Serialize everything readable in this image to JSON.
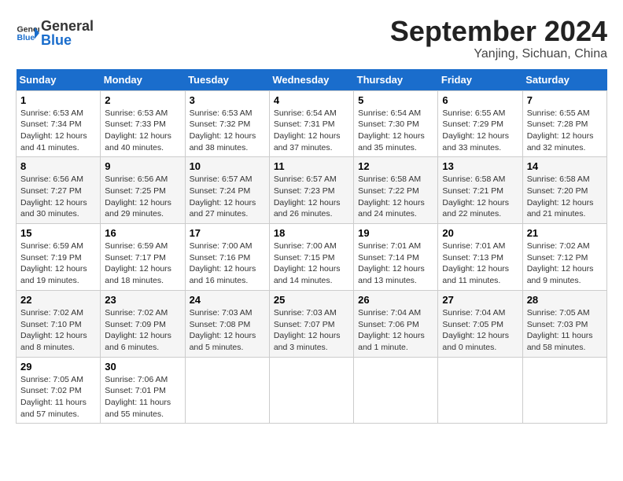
{
  "header": {
    "logo_text_general": "General",
    "logo_text_blue": "Blue",
    "month": "September 2024",
    "location": "Yanjing, Sichuan, China"
  },
  "weekdays": [
    "Sunday",
    "Monday",
    "Tuesday",
    "Wednesday",
    "Thursday",
    "Friday",
    "Saturday"
  ],
  "weeks": [
    [
      {
        "day": "1",
        "info": "Sunrise: 6:53 AM\nSunset: 7:34 PM\nDaylight: 12 hours and 41 minutes."
      },
      {
        "day": "2",
        "info": "Sunrise: 6:53 AM\nSunset: 7:33 PM\nDaylight: 12 hours and 40 minutes."
      },
      {
        "day": "3",
        "info": "Sunrise: 6:53 AM\nSunset: 7:32 PM\nDaylight: 12 hours and 38 minutes."
      },
      {
        "day": "4",
        "info": "Sunrise: 6:54 AM\nSunset: 7:31 PM\nDaylight: 12 hours and 37 minutes."
      },
      {
        "day": "5",
        "info": "Sunrise: 6:54 AM\nSunset: 7:30 PM\nDaylight: 12 hours and 35 minutes."
      },
      {
        "day": "6",
        "info": "Sunrise: 6:55 AM\nSunset: 7:29 PM\nDaylight: 12 hours and 33 minutes."
      },
      {
        "day": "7",
        "info": "Sunrise: 6:55 AM\nSunset: 7:28 PM\nDaylight: 12 hours and 32 minutes."
      }
    ],
    [
      {
        "day": "8",
        "info": "Sunrise: 6:56 AM\nSunset: 7:27 PM\nDaylight: 12 hours and 30 minutes."
      },
      {
        "day": "9",
        "info": "Sunrise: 6:56 AM\nSunset: 7:25 PM\nDaylight: 12 hours and 29 minutes."
      },
      {
        "day": "10",
        "info": "Sunrise: 6:57 AM\nSunset: 7:24 PM\nDaylight: 12 hours and 27 minutes."
      },
      {
        "day": "11",
        "info": "Sunrise: 6:57 AM\nSunset: 7:23 PM\nDaylight: 12 hours and 26 minutes."
      },
      {
        "day": "12",
        "info": "Sunrise: 6:58 AM\nSunset: 7:22 PM\nDaylight: 12 hours and 24 minutes."
      },
      {
        "day": "13",
        "info": "Sunrise: 6:58 AM\nSunset: 7:21 PM\nDaylight: 12 hours and 22 minutes."
      },
      {
        "day": "14",
        "info": "Sunrise: 6:58 AM\nSunset: 7:20 PM\nDaylight: 12 hours and 21 minutes."
      }
    ],
    [
      {
        "day": "15",
        "info": "Sunrise: 6:59 AM\nSunset: 7:19 PM\nDaylight: 12 hours and 19 minutes."
      },
      {
        "day": "16",
        "info": "Sunrise: 6:59 AM\nSunset: 7:17 PM\nDaylight: 12 hours and 18 minutes."
      },
      {
        "day": "17",
        "info": "Sunrise: 7:00 AM\nSunset: 7:16 PM\nDaylight: 12 hours and 16 minutes."
      },
      {
        "day": "18",
        "info": "Sunrise: 7:00 AM\nSunset: 7:15 PM\nDaylight: 12 hours and 14 minutes."
      },
      {
        "day": "19",
        "info": "Sunrise: 7:01 AM\nSunset: 7:14 PM\nDaylight: 12 hours and 13 minutes."
      },
      {
        "day": "20",
        "info": "Sunrise: 7:01 AM\nSunset: 7:13 PM\nDaylight: 12 hours and 11 minutes."
      },
      {
        "day": "21",
        "info": "Sunrise: 7:02 AM\nSunset: 7:12 PM\nDaylight: 12 hours and 9 minutes."
      }
    ],
    [
      {
        "day": "22",
        "info": "Sunrise: 7:02 AM\nSunset: 7:10 PM\nDaylight: 12 hours and 8 minutes."
      },
      {
        "day": "23",
        "info": "Sunrise: 7:02 AM\nSunset: 7:09 PM\nDaylight: 12 hours and 6 minutes."
      },
      {
        "day": "24",
        "info": "Sunrise: 7:03 AM\nSunset: 7:08 PM\nDaylight: 12 hours and 5 minutes."
      },
      {
        "day": "25",
        "info": "Sunrise: 7:03 AM\nSunset: 7:07 PM\nDaylight: 12 hours and 3 minutes."
      },
      {
        "day": "26",
        "info": "Sunrise: 7:04 AM\nSunset: 7:06 PM\nDaylight: 12 hours and 1 minute."
      },
      {
        "day": "27",
        "info": "Sunrise: 7:04 AM\nSunset: 7:05 PM\nDaylight: 12 hours and 0 minutes."
      },
      {
        "day": "28",
        "info": "Sunrise: 7:05 AM\nSunset: 7:03 PM\nDaylight: 11 hours and 58 minutes."
      }
    ],
    [
      {
        "day": "29",
        "info": "Sunrise: 7:05 AM\nSunset: 7:02 PM\nDaylight: 11 hours and 57 minutes."
      },
      {
        "day": "30",
        "info": "Sunrise: 7:06 AM\nSunset: 7:01 PM\nDaylight: 11 hours and 55 minutes."
      },
      {
        "day": "",
        "info": ""
      },
      {
        "day": "",
        "info": ""
      },
      {
        "day": "",
        "info": ""
      },
      {
        "day": "",
        "info": ""
      },
      {
        "day": "",
        "info": ""
      }
    ]
  ]
}
